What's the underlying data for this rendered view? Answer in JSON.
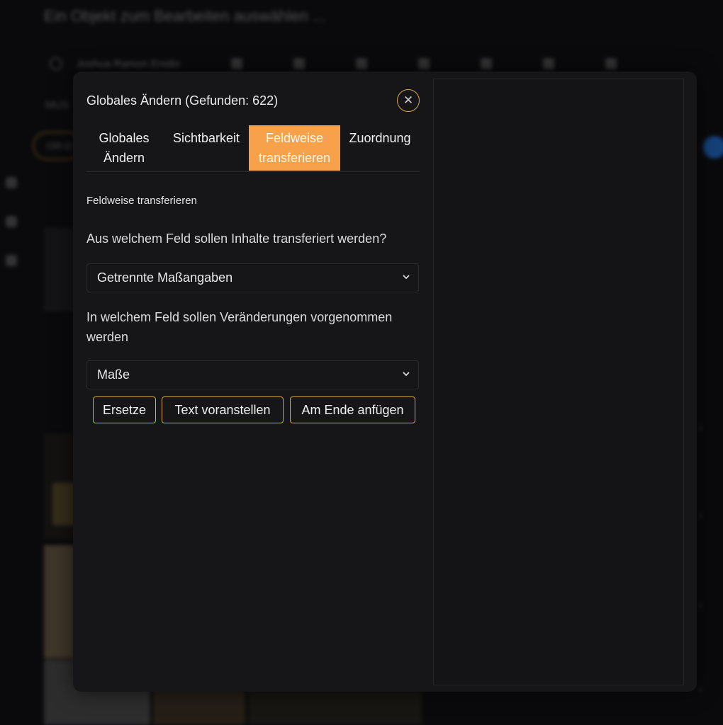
{
  "background": {
    "title": "Ein Objekt zum Bearbeiten auswählen ...",
    "user": "Joshua Ramon Enslin",
    "multi_label": "MUS",
    "pill_label": "OR-D"
  },
  "modal": {
    "title": "Globales Ändern (Gefunden: 622)",
    "close_glyph": "✕",
    "tabs": [
      {
        "label": "Globales Ändern",
        "active": false
      },
      {
        "label": "Sichtbarkeit",
        "active": false
      },
      {
        "label": "Feldweise transferieren",
        "active": true
      },
      {
        "label": "Zuordnung",
        "active": false
      }
    ],
    "section_heading": "Feldweise transferieren",
    "source_question": "Aus welchem Feld sollen Inhalte transferiert werden?",
    "source_select": {
      "value": "Getrennte Maßangaben",
      "icon": "chevron-down-icon"
    },
    "target_question": "In welchem Feld sollen Veränderungen vorgenommen werden",
    "target_select": {
      "value": "Maße",
      "icon": "chevron-down-icon"
    },
    "actions": {
      "replace": "Ersetze",
      "prepend": "Text voranstellen",
      "append": "Am Ende anfügen"
    }
  },
  "colors": {
    "accent": "#f7a24a",
    "border_accent": "#d8a84a",
    "modal_bg": "#161517",
    "page_bg": "#0a0a0c"
  }
}
